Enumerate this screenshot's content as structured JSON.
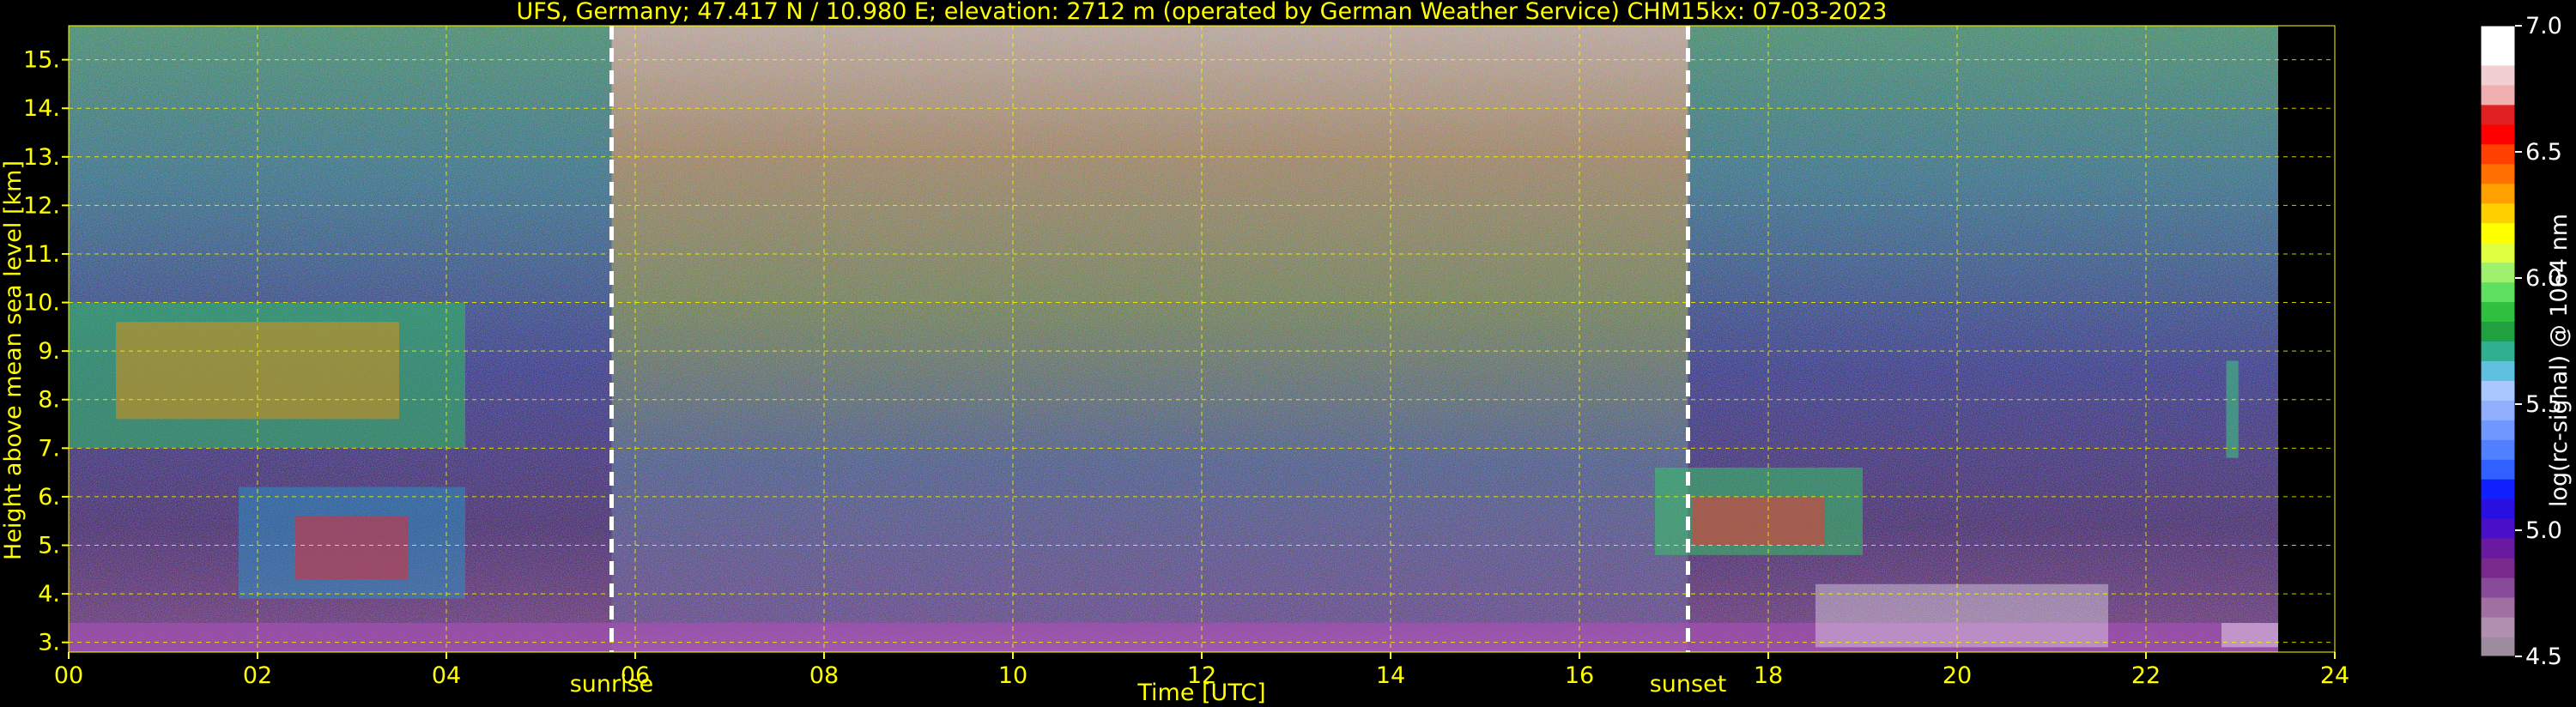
{
  "chart_data": {
    "type": "heatmap",
    "title": "UFS, Germany; 47.417 N / 10.980 E; elevation: 2712 m  (operated by German Weather Service)    CHM15kx: 07-03-2023",
    "xlabel": "Time [UTC]",
    "ylabel": "Height above mean sea level [km]",
    "xlim": [
      0,
      24
    ],
    "ylim": [
      2.8,
      15.7
    ],
    "x_ticks": [
      "00",
      "02",
      "04",
      "06",
      "08",
      "10",
      "12",
      "14",
      "16",
      "18",
      "20",
      "22",
      "24"
    ],
    "y_ticks": [
      "3.",
      "4.",
      "5.",
      "6.",
      "7.",
      "8.",
      "9.",
      "10.",
      "11.",
      "12.",
      "13.",
      "14.",
      "15."
    ],
    "grid": true,
    "events": [
      {
        "label": "sunrise",
        "x": 5.75
      },
      {
        "label": "sunset",
        "x": 17.15
      }
    ],
    "data_end_x": 23.4,
    "colorbar": {
      "label": "log(rc-signal) @ 1064 nm",
      "range": [
        4.5,
        7.0
      ],
      "ticks": [
        "4.5",
        "5.0",
        "5.5",
        "6.0",
        "6.5",
        "7.0"
      ],
      "colors": [
        "#9e8c9e",
        "#b08fb0",
        "#a070a0",
        "#8a4a9a",
        "#7a2a8c",
        "#6a1aa0",
        "#4a10c8",
        "#2a10e0",
        "#1020ff",
        "#3060ff",
        "#5080ff",
        "#7098ff",
        "#90b0ff",
        "#a8c8ff",
        "#60c0e0",
        "#30b090",
        "#20a040",
        "#30c040",
        "#60e060",
        "#a0f070",
        "#e0ff40",
        "#ffff00",
        "#ffd000",
        "#ffa000",
        "#ff7000",
        "#ff4000",
        "#ff0000",
        "#e02020",
        "#f0b0b0",
        "#f0d0d0",
        "#ffffff",
        "#ffffff"
      ]
    },
    "colors": {
      "axis_text": "#ffff00",
      "grid": "#ffff00",
      "event_line": "#ffffff",
      "background": "#000000"
    }
  }
}
